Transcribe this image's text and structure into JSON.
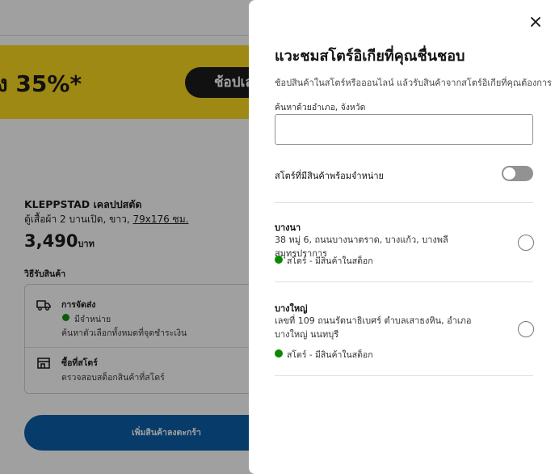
{
  "background": {
    "promo_text": "ง 35%*",
    "promo_button": "ช้อปเล",
    "product_name": "KLEPPSTAD เคลปปสตัด",
    "product_desc_prefix": "ตู้เสื้อผ้า 2 บานเปิด, ขาว, ",
    "product_dimensions": "79x176 ซม.",
    "price_value": "3,490",
    "price_currency": "บาท",
    "buy_options_title": "วิธีรับสินค้า",
    "delivery": {
      "title": "การจัดส่ง",
      "status": "มีจำหน่าย",
      "note": "ค้นหาตัวเลือกทั้งหมดที่จุดชำระเงิน"
    },
    "in_store": {
      "title": "ซื้อที่สโตร์",
      "note": "ตรวจสอบสต็อกสินค้าที่สโตร์"
    },
    "add_to_cart": "เพิ่มสินค้าลงตะกร้า"
  },
  "modal": {
    "title": "แวะชมสโตร์อิเกียที่คุณชื่นชอบ",
    "subtitle": "ช้อปสินค้าในสโตร์หรือออนไลน์ แล้วรับสินค้าจากสโตร์อิเกียที่คุณต้องการ",
    "search_label": "ค้นหาด้วยอำเภอ, จังหวัด",
    "search_value": "",
    "toggle_label": "สโตร์ที่มีสินค้าพร้อมจำหน่าย",
    "toggle_on": false,
    "stores": [
      {
        "name": "บางนา",
        "address": "38 หมู่ 6, ถนนบางนาตราด, บางแก้ว, บางพลี สมุทรปราการ",
        "status": "สโตร์ - มีสินค้าในสต็อก",
        "selected": false
      },
      {
        "name": "บางใหญ่",
        "address": "เลขที่ 109 ถนนรัตนาธิเบศร์ ตำบลเสาธงหิน, อำเภอบางใหญ่ นนทบุรี",
        "status": "สโตร์ - มีสินค้าในสต็อก",
        "selected": false
      }
    ]
  },
  "colors": {
    "promo_yellow": "#fbd914",
    "cart_blue": "#0058a3",
    "in_stock_green": "#0a8a00",
    "overlay": "rgba(17,17,17,0.4)"
  },
  "icons": [
    "close-icon",
    "truck-icon",
    "store-icon"
  ]
}
